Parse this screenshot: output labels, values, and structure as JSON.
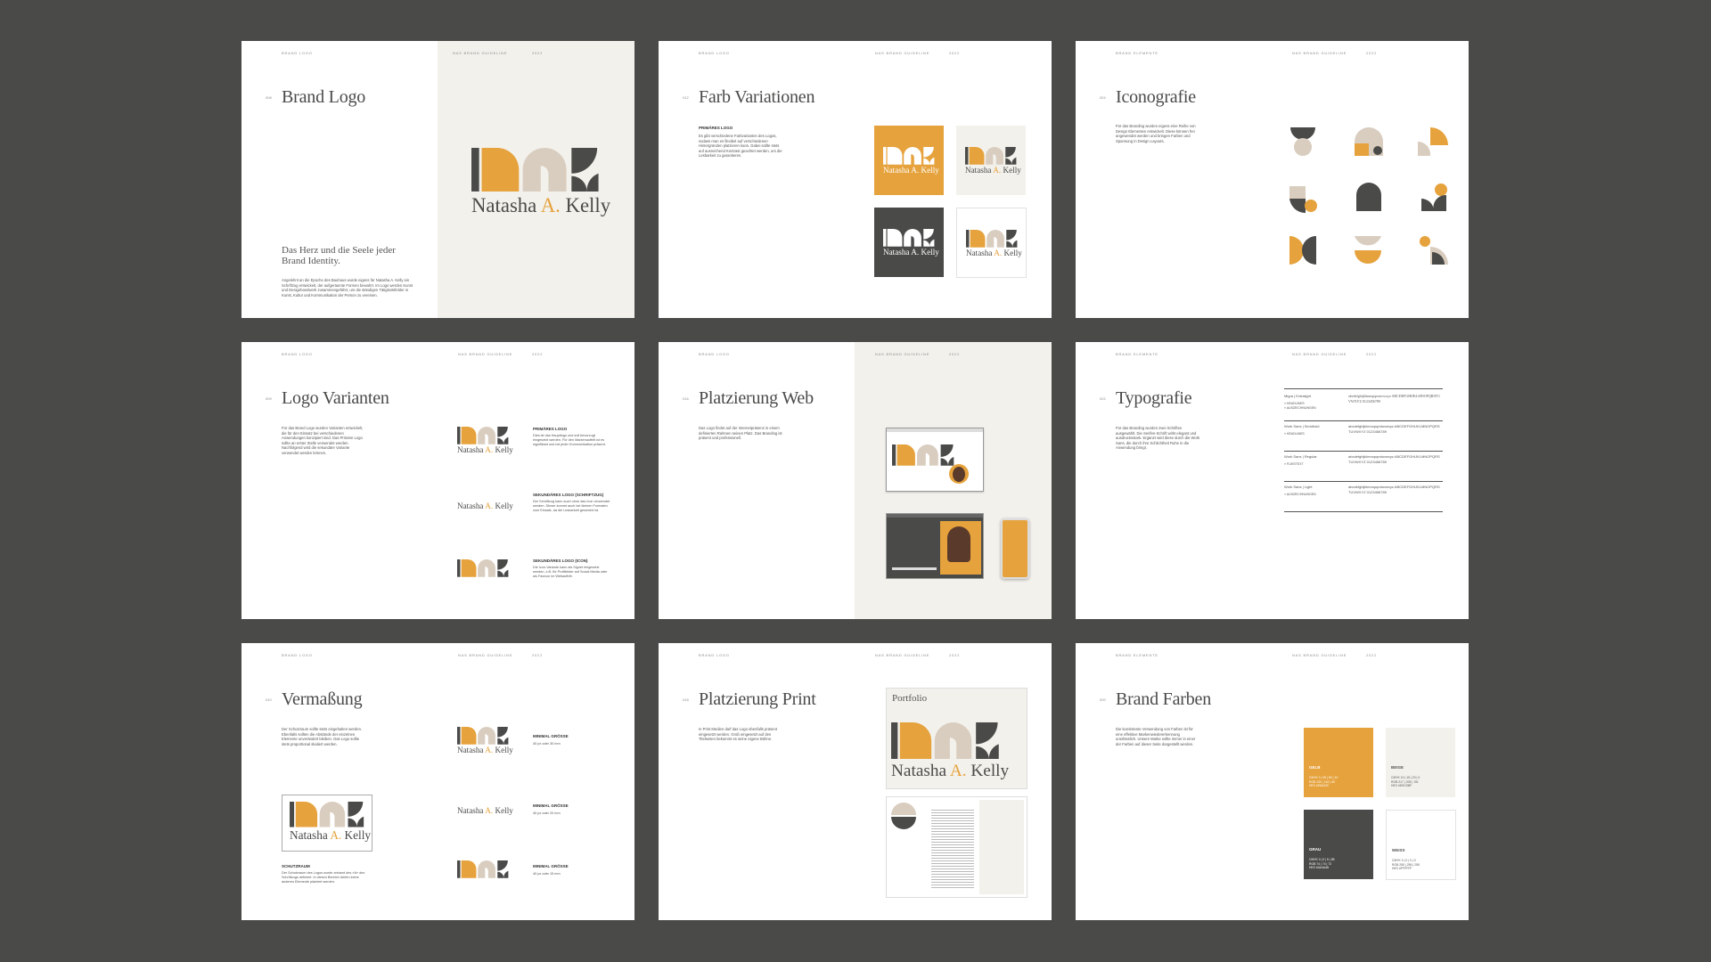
{
  "colors": {
    "accent": "#e6a23c",
    "dark": "#4a4a48",
    "beige": "#d9cdbf",
    "offwhite": "#f3f1ec",
    "bg": "#4a4a48"
  },
  "header": {
    "brand_logo": "BRAND LOGO",
    "guideline": "NAS BRAND GUIDELINE",
    "year": "2022",
    "brand_elements": "BRAND ELEMENTE"
  },
  "logo": {
    "name_first": "Natasha ",
    "name_mid": "A.",
    "name_last": " Kelly"
  },
  "pages": {
    "p1": {
      "num": "008",
      "title": "Brand Logo",
      "subtitle": "Das Herz und die Seele jeder Brand Identity.",
      "body": "Angelehnt an die Epoche des Bauhaus wurde eigens für Natasha A. Kelly ein Schriftzug entwickelt, der aufgeräumte Formen bewahrt. Im Logo werden Kunst und Designhandwerk zusammengeführt, um die ständigen Tätigkeitsfelder in Kunst, Kultur und Kommunikation der Person zu vereinen."
    },
    "p2": {
      "num": "012",
      "title": "Farb Variationen",
      "label": "PRIMÄRES LOGO",
      "body": "Es gibt verschiedene Farbvarianten des Logos, sodass man es flexibel auf verschiedenen Hintergründen platzieren kann. Dabei sollte stets auf ausreichend Kontrast geachtet werden, um die Lesbarkeit zu garantieren."
    },
    "p3": {
      "num": "024",
      "title": "Iconografie",
      "body": "Für das Branding wurden eigens eine Reihe von Design Elementen entwickelt. Diese können frei angewendet werden und bringen Farben und Spannung in Design Layouts."
    },
    "p4": {
      "num": "009",
      "title": "Logo Varianten",
      "body": "Für das Brand Logo wurden Varianten entwickelt, die für den Einsatz bei verschiedenen Anwendungen konzipiert sind. Das Primäre Logo sollte an erster Stelle verwendet werden. Nachfolgend wird die sekundäre Variante verwendet werden können.",
      "v1_label": "PRIMÄRES LOGO",
      "v1_body": "Dies ist das Hauptlogo und soll bevorzugt eingesetzt werden. Für den Markenauftritt ist es signifikant und bei jeder Kommunikation präsent.",
      "v2_label": "SEKUNDÄRES LOGO (SCHRIFTZUG)",
      "v2_body": "Der Schriftzug kann auch ohne das Icon verwendet werden. Dieser kommt auch bei kleinen Formaten zum Einsatz, da die Lesbarkeit gesichert ist.",
      "v3_label": "SEKUNDÄRES LOGO (ICON)",
      "v3_body": "Die Icon-Variante kann als Signet eingesetzt werden, z.B. für Profilbilder auf Social Media oder als Favicon im Webauftritt."
    },
    "p5": {
      "num": "016",
      "title": "Platzierung Web",
      "body": "Das Logo findet auf der Internetpräsenz in einem definierten Rahmen seinen Platz. Das Branding ist präsent und professionell."
    },
    "p6": {
      "num": "022",
      "title": "Typografie",
      "body": "Für das Branding wurden zwei Schriften ausgewählt. Die Serifen-Schrift wirkt elegant und ausdrucksstark. Ergänzt wird diese durch die Work Sans, die durch ihre Schlichtheit Ruhe in die Anwendung bringt.",
      "rows": [
        {
          "name": "Migra | Extralight",
          "uses": [
            "» HEADLINES",
            "» AUSZEICHNUNGEN"
          ],
          "sample": "abcdefghijklmnopqrstuvwxyz ABCDEFGHIJKLMNOPQRSTUVWXYZ 0123456789"
        },
        {
          "name": "Work Sans | Semibold",
          "uses": [
            "» HEADLINES"
          ],
          "sample": "abcdefghijklmnopqrstuvwxyz ABCDEFGHIJKLMNOPQRSTUVWXYZ 0123456789"
        },
        {
          "name": "Work Sans | Regular",
          "uses": [
            "» FLIESTEXT"
          ],
          "sample": "abcdefghijklmnopqrstuvwxyz ABCDEFGHIJKLMNOPQRSTUVWXYZ 0123456789"
        },
        {
          "name": "Work Sans | Light",
          "uses": [
            "» AUSZEICHNUNGEN"
          ],
          "sample": "abcdefghijklmnopqrstuvwxyz ABCDEFGHIJKLMNOPQRSTUVWXYZ 0123456789"
        }
      ]
    },
    "p7": {
      "num": "010",
      "title": "Vermaßung",
      "body": "Der Schutzraum sollte stets eingehalten werden. Ebenfalls sollten die Abstände der einzelnen Elemente unverändert bleiben. Das Logo sollte stets proportional skaliert werden.",
      "s_label": "SCHUTZRAUM",
      "s_body": "Der Schutzraum des Logos wurde anhand des »A« des Schriftzugs definiert. In diesen Bereich dürfen keine anderen Elemente platziert werden.",
      "m1_label": "MINIMAL GRÖßE",
      "m1_val": "40 px oder 30 mm",
      "m2_label": "MINIMAL GRÖßE",
      "m2_val": "40 px oder 20 mm",
      "m3_label": "MINIMAL GRÖßE",
      "m3_val": "40 px oder 15 mm"
    },
    "p8": {
      "num": "018",
      "title": "Platzierung Print",
      "body": "In Print Medien darf das Logo ebenfalls präsent eingesetzt werden. Groß eingesetzt auf den Titelseiten bekommt es seine eigene Bühne.",
      "portfolio": "Portfolio"
    },
    "p9": {
      "num": "020",
      "title": "Brand Farben",
      "body": "Die konsistente Verwendung von Farben ist für eine effektive Markenwiedererkennung unerlässlich. Unsere Marke sollte immer in einer der Farben auf dieser Seite dargestellt werden.",
      "swatches": [
        {
          "name": "GELB",
          "spec": "CMYK 0 | 35 | 80 | 10\nRGB 230 | 162 | 60\nHEX #E6A23C"
        },
        {
          "name": "BEIGE",
          "spec": "CMYK 10 | 15 | 20 | 0\nRGB 217 | 205 | 191\nHEX #D9CDBF"
        },
        {
          "name": "GRAU",
          "spec": "CMYK 0 | 0 | 5 | 85\nRGB 74 | 74 | 72\nHEX #4A4A48"
        },
        {
          "name": "WEISS",
          "spec": "CMYK 0 | 0 | 0 | 0\nRGB 255 | 255 | 255\nHEX #FFFFFF"
        }
      ]
    }
  }
}
